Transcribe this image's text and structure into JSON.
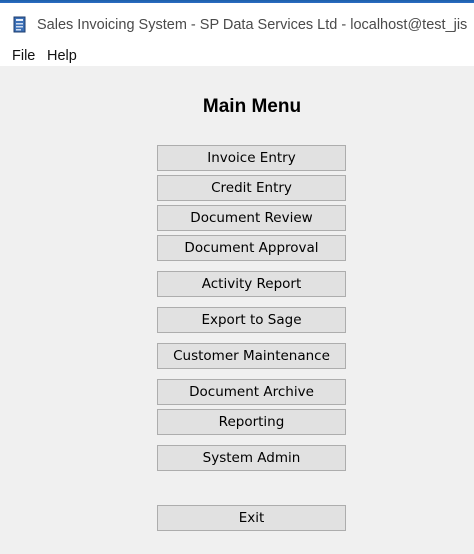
{
  "window": {
    "title": "Sales Invoicing System - SP Data Services Ltd - localhost@test_jis"
  },
  "menubar": {
    "items": [
      {
        "label": "File"
      },
      {
        "label": "Help"
      }
    ]
  },
  "main": {
    "title": "Main Menu",
    "buttons": [
      {
        "label": "Invoice Entry"
      },
      {
        "label": "Credit Entry"
      },
      {
        "label": "Document Review"
      },
      {
        "label": "Document Approval"
      },
      {
        "label": "Activity Report"
      },
      {
        "label": "Export to Sage"
      },
      {
        "label": "Customer Maintenance"
      },
      {
        "label": "Document Archive"
      },
      {
        "label": "Reporting"
      },
      {
        "label": "System Admin"
      },
      {
        "label": "Exit"
      }
    ]
  },
  "colors": {
    "button_face": "#e1e1e1",
    "button_border": "#adadad",
    "background": "#f0f0f0",
    "titlebar": "#ffffff"
  }
}
